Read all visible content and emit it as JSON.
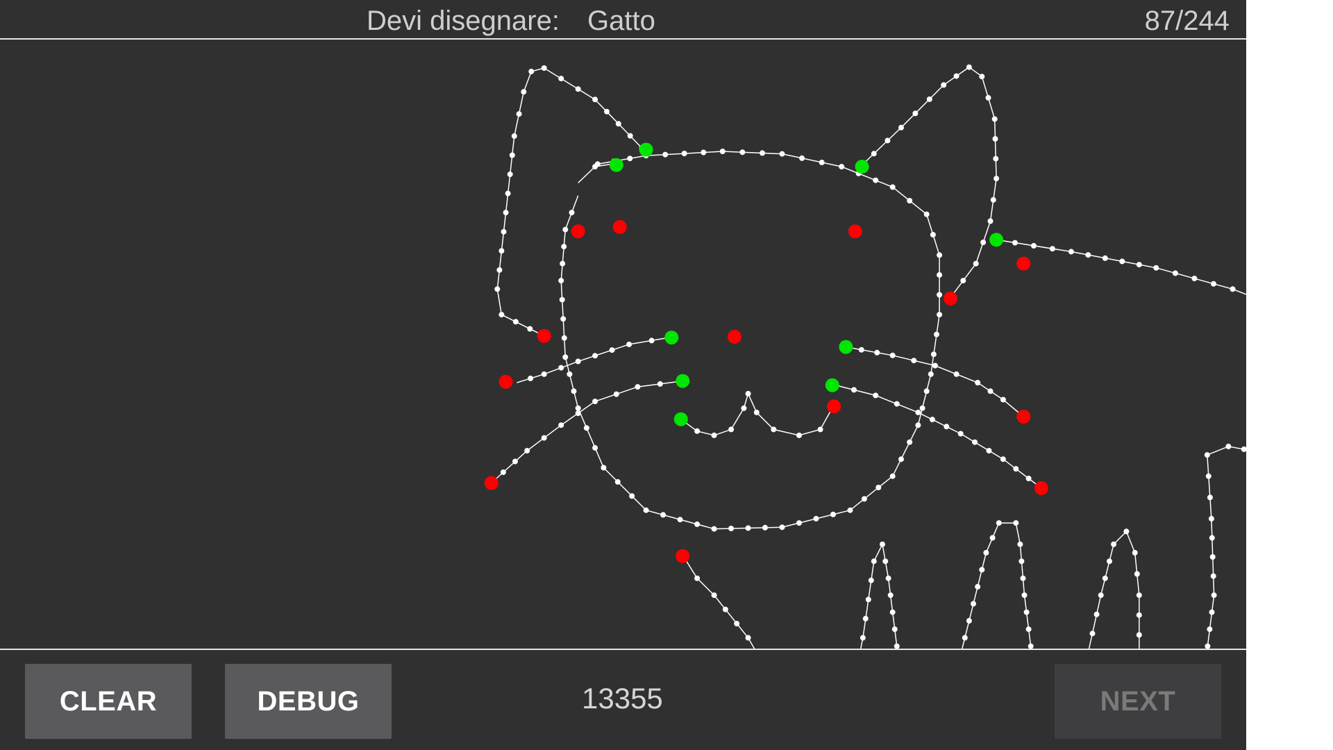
{
  "header": {
    "prompt_label": "Devi disegnare:",
    "prompt_word": "Gatto",
    "counter": "87/244"
  },
  "footer": {
    "clear_label": "CLEAR",
    "debug_label": "DEBUG",
    "score": "13355",
    "next_label": "NEXT"
  },
  "colors": {
    "background": "#303030",
    "stroke": "#ffffff",
    "stroke_start": "#00e600",
    "stroke_end": "#ff0000",
    "button": "#5a5a5c",
    "button_disabled": "#3e3e40"
  }
}
